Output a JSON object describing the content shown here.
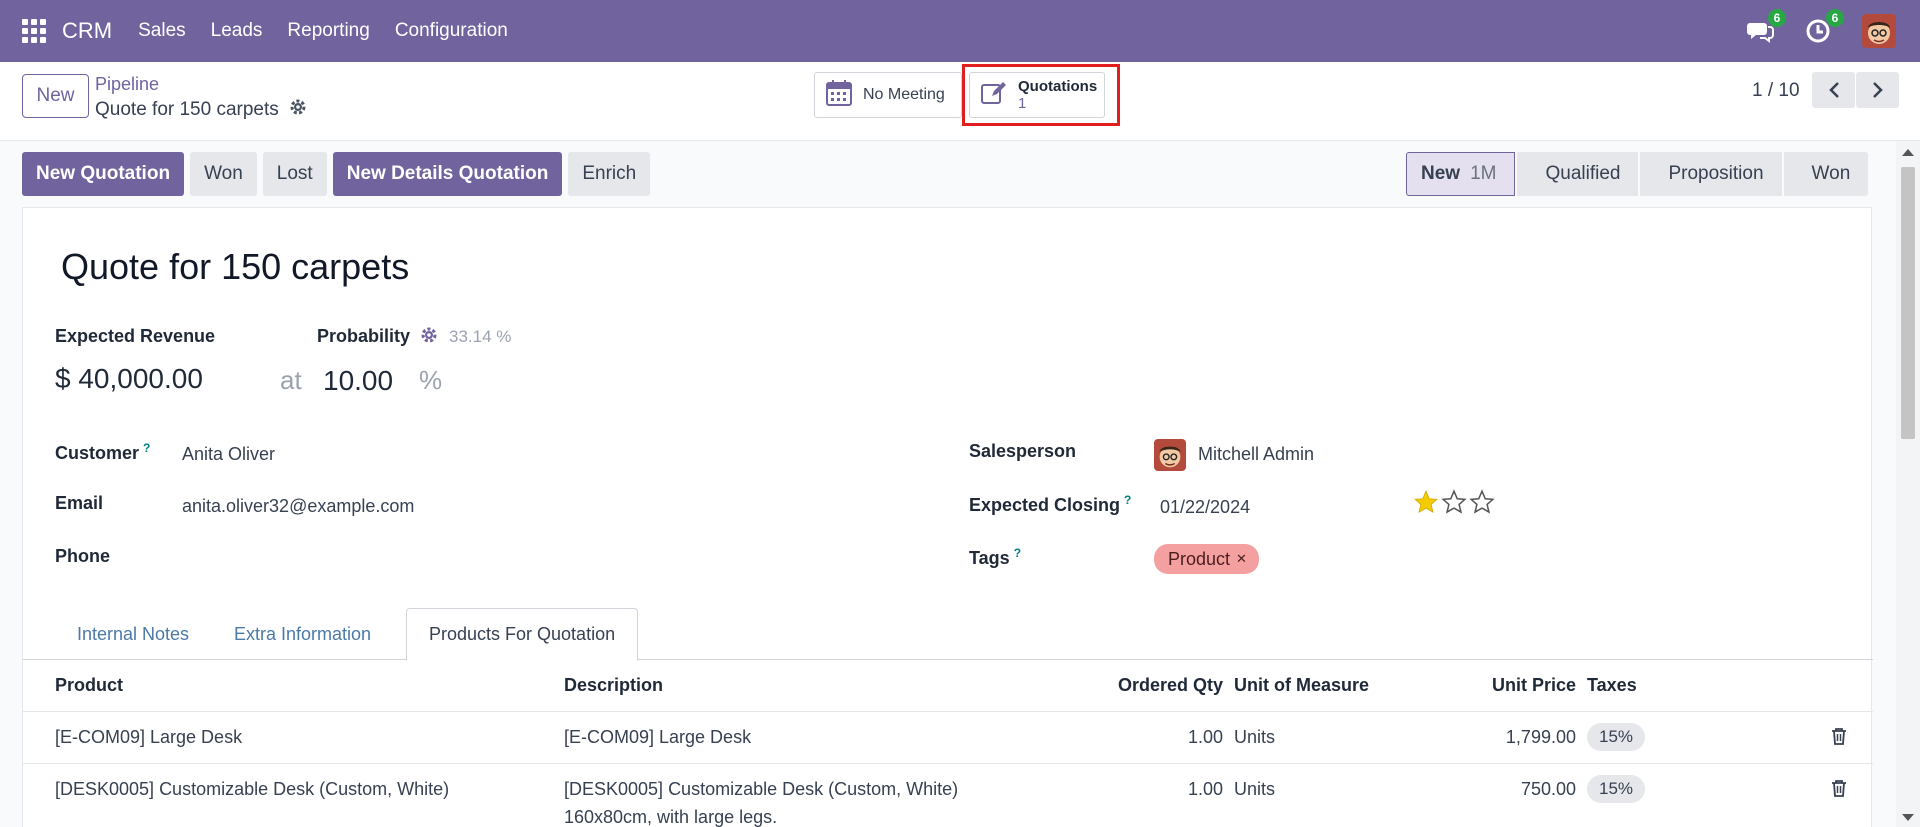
{
  "navbar": {
    "app_name": "CRM",
    "menu": [
      "Sales",
      "Leads",
      "Reporting",
      "Configuration"
    ],
    "messages_count": "6",
    "activities_count": "6"
  },
  "control_panel": {
    "new_label": "New",
    "breadcrumb_parent": "Pipeline",
    "breadcrumb_current": "Quote for 150 carpets",
    "smart_meeting": "No Meeting",
    "smart_quotations_label": "Quotations",
    "smart_quotations_value": "1",
    "pager": "1 / 10"
  },
  "actions": [
    "New Quotation",
    "Won",
    "Lost",
    "New Details Quotation",
    "Enrich"
  ],
  "stages": [
    {
      "label": "New",
      "sub": "1M",
      "active": true
    },
    {
      "label": "Qualified"
    },
    {
      "label": "Proposition"
    },
    {
      "label": "Won"
    }
  ],
  "form": {
    "title": "Quote for 150 carpets",
    "expected_revenue_label": "Expected Revenue",
    "expected_revenue": "$ 40,000.00",
    "at_label": "at",
    "probability_label": "Probability",
    "probability_auto": "33.14 %",
    "probability": "10.00",
    "percent_sign": "%",
    "customer_label": "Customer",
    "customer": "Anita Oliver",
    "email_label": "Email",
    "email": "anita.oliver32@example.com",
    "phone_label": "Phone",
    "salesperson_label": "Salesperson",
    "salesperson": "Mitchell Admin",
    "expected_closing_label": "Expected Closing",
    "expected_closing": "01/22/2024",
    "priority_stars": 1,
    "tags_label": "Tags",
    "tag": "Product",
    "help_mark": "?"
  },
  "tabs": [
    "Internal Notes",
    "Extra Information",
    "Products For Quotation"
  ],
  "active_tab": 2,
  "table": {
    "headers": [
      "Product",
      "Description",
      "Ordered Qty",
      "Unit of Measure",
      "Unit Price",
      "Taxes"
    ],
    "rows": [
      {
        "product": "[E-COM09] Large Desk",
        "description": "[E-COM09] Large Desk",
        "description2": "",
        "qty": "1.00",
        "uom": "Units",
        "price": "1,799.00",
        "tax": "15%"
      },
      {
        "product": "[DESK0005] Customizable Desk (Custom, White)",
        "description": "[DESK0005] Customizable Desk (Custom, White)",
        "description2": "160x80cm, with large legs.",
        "qty": "1.00",
        "uom": "Units",
        "price": "750.00",
        "tax": "15%"
      }
    ]
  },
  "colors": {
    "brand": "#71639e",
    "highlight": "#e11d1d",
    "badge": "#28a745",
    "tag": "#f4a0a0",
    "star": "#f3cc00"
  }
}
